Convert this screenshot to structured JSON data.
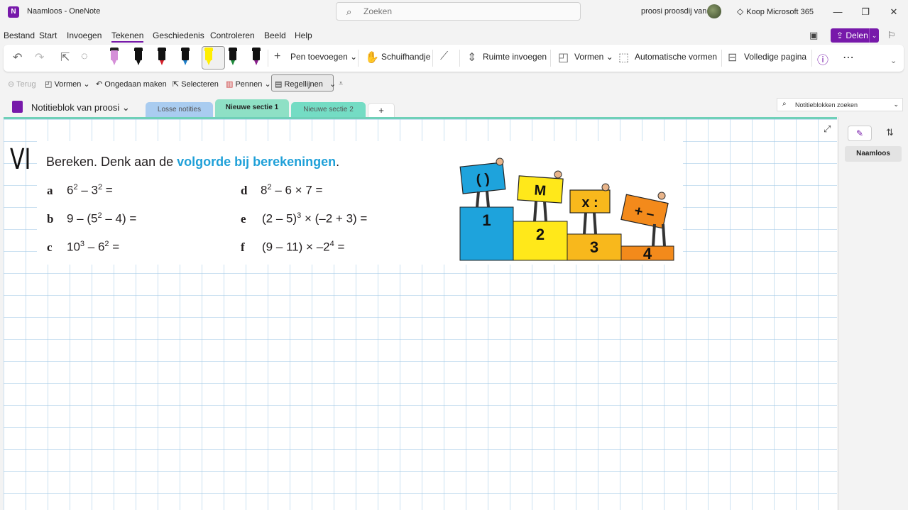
{
  "app": {
    "icon_letter": "N",
    "title": "Naamloos  -  OneNote",
    "search_placeholder": "Zoeken",
    "user_name": "proosi proosdij van",
    "buy_label": "Koop Microsoft 365"
  },
  "menu": {
    "tabs": [
      "Bestand",
      "Start",
      "Invoegen",
      "Tekenen",
      "Geschiedenis",
      "Controleren",
      "Beeld",
      "Help"
    ],
    "active_tab": "Tekenen",
    "share_label": "Delen"
  },
  "ribbon": {
    "pens": [
      {
        "color": "#d58fd8",
        "cap": "#222222"
      },
      {
        "color": "#111111",
        "cap": "#111111"
      },
      {
        "color": "#d6202a",
        "cap": "#111111"
      },
      {
        "color": "#1f7fc9",
        "cap": "#111111"
      },
      {
        "color": "#ffee00",
        "cap": "#ffee00"
      },
      {
        "color": "#1e8a3c",
        "cap": "#111111"
      },
      {
        "color": "#8a1e8c",
        "cap": "#111111"
      }
    ],
    "add_pen": "Pen toevoegen",
    "pan": "Schuifhandje",
    "insert_space": "Ruimte invoegen",
    "shapes": "Vormen",
    "auto_shapes": "Automatische vormen",
    "full_page": "Volledige pagina"
  },
  "subbar": {
    "back": "Terug",
    "shapes": "Vormen",
    "undo": "Ongedaan maken",
    "select": "Selecteren",
    "pens": "Pennen",
    "rule_lines": "Regellijnen"
  },
  "notebook": {
    "name": "Notitieblok van proosi",
    "sections": [
      {
        "label": "Losse notities",
        "color": "#a9ccf0"
      },
      {
        "label": "Nieuwe sectie 1",
        "color": "#8ee0c5"
      },
      {
        "label": "Nieuwe sectie 2",
        "color": "#74dcc4"
      }
    ],
    "add_tab": "+",
    "search_placeholder": "Notitieblokken zoeken"
  },
  "worksheet": {
    "handwritten": "VI",
    "title_prefix": "Bereken. Denk aan de ",
    "title_highlight": "volgorde bij berekeningen",
    "title_suffix": ".",
    "exercises": [
      {
        "letter": "a",
        "base1": "6",
        "exp1": "2",
        "mid": " – 3",
        "exp2": "2",
        "rest": " ="
      },
      {
        "letter": "b",
        "base1": "9 – (5",
        "exp1": "2",
        "mid": " – 4) =",
        "exp2": "",
        "rest": ""
      },
      {
        "letter": "c",
        "base1": "10",
        "exp1": "3",
        "mid": " – 6",
        "exp2": "2",
        "rest": " ="
      },
      {
        "letter": "d",
        "base1": "8",
        "exp1": "2",
        "mid": " – 6 × 7 =",
        "exp2": "",
        "rest": ""
      },
      {
        "letter": "e",
        "base1": "(2 – 5)",
        "exp1": "3",
        "mid": " × (–2 + 3) =",
        "exp2": "",
        "rest": ""
      },
      {
        "letter": "f",
        "base1": "(9 – 11) × –2",
        "exp1": "4",
        "mid": " =",
        "exp2": "",
        "rest": ""
      }
    ],
    "podium": {
      "signs": [
        "( )",
        "M",
        "x :",
        "+ –"
      ],
      "places": [
        "1",
        "2",
        "3",
        "4"
      ],
      "colors": [
        "#1ea3dc",
        "#ffe81a",
        "#f8b81c",
        "#f38a1b"
      ]
    }
  },
  "pages_pane": {
    "pages": [
      "Naamloos"
    ]
  }
}
